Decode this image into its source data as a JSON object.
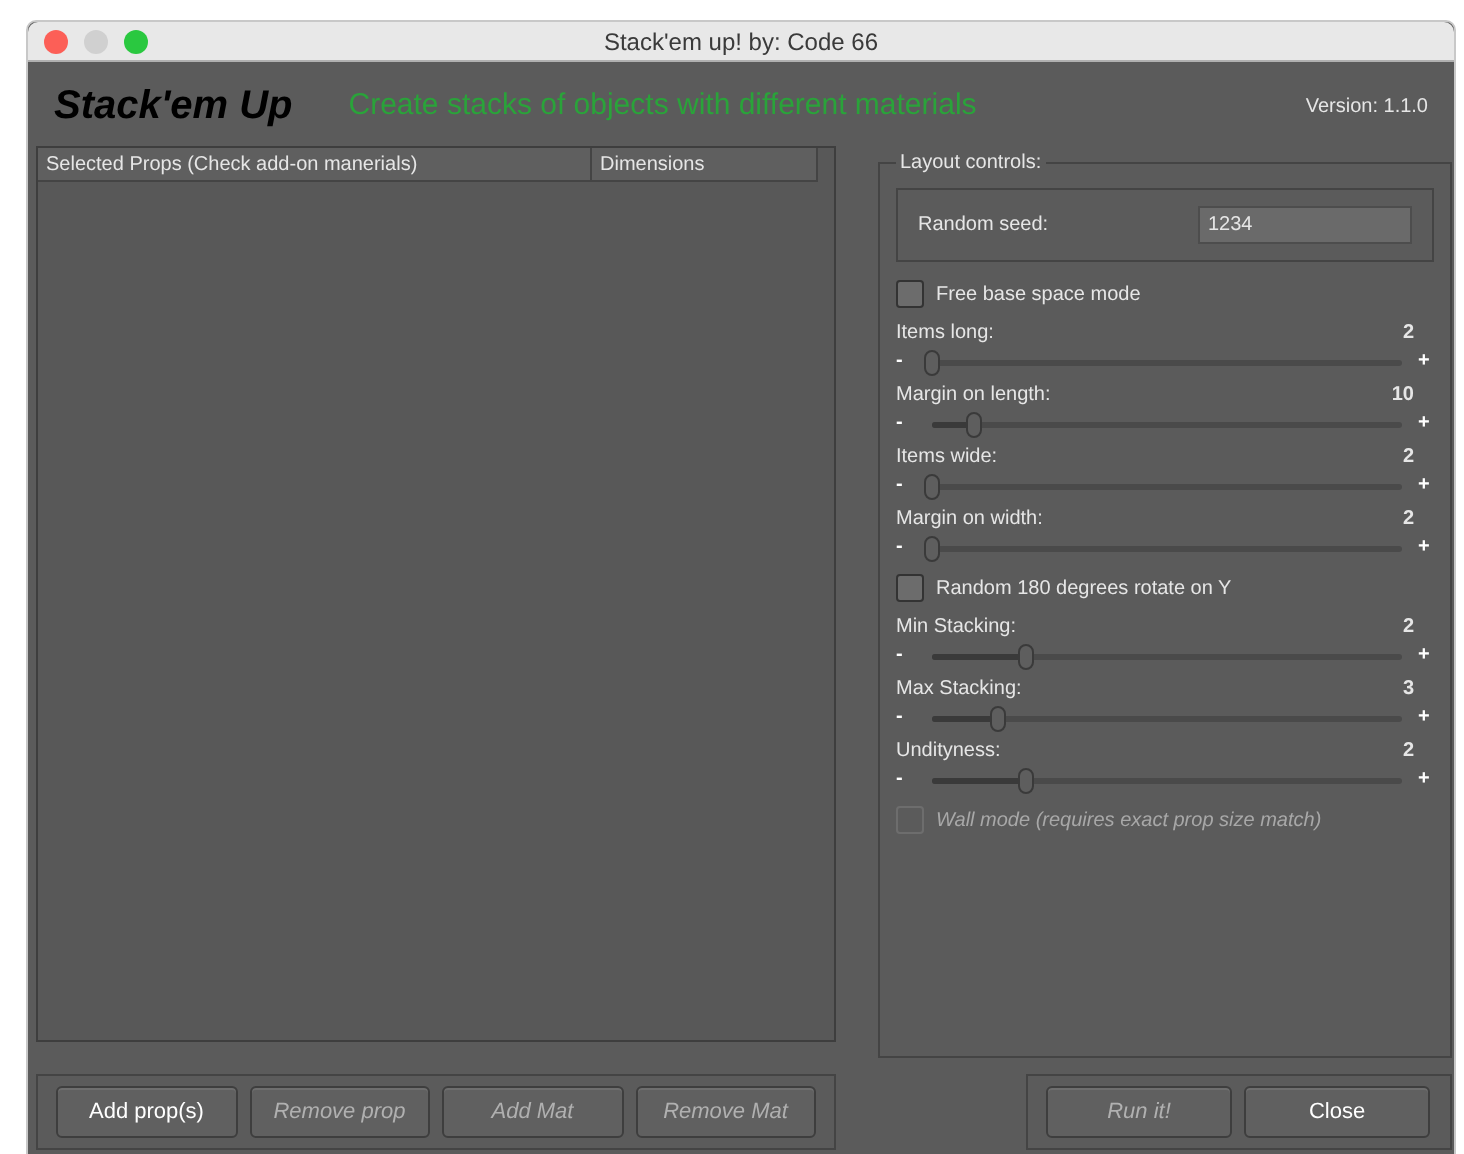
{
  "window": {
    "title": "Stack'em up! by: Code 66"
  },
  "header": {
    "title": "Stack'em Up",
    "subtitle": "Create stacks of objects with different materials",
    "version": "Version: 1.1.0"
  },
  "table": {
    "columns": [
      "Selected Props (Check add-on manerials)",
      "Dimensions"
    ]
  },
  "left_buttons": [
    {
      "label": "Add prop(s)",
      "disabled": false
    },
    {
      "label": "Remove prop",
      "disabled": true
    },
    {
      "label": "Add Mat",
      "disabled": true
    },
    {
      "label": "Remove Mat",
      "disabled": true
    }
  ],
  "layout_controls": {
    "title": "Layout controls:",
    "seed_label": "Random seed:",
    "seed_value": "1234",
    "items": [
      {
        "kind": "checkbox",
        "label": "Free base space mode",
        "checked": false,
        "disabled": false
      },
      {
        "kind": "slider",
        "label": "Items long:",
        "reading": "2",
        "minus": "-",
        "plus": "+",
        "level": 0.0
      },
      {
        "kind": "slider",
        "label": "Margin on length:",
        "reading": "10",
        "minus": "-",
        "plus": "+",
        "level": 0.09
      },
      {
        "kind": "slider",
        "label": "Items wide:",
        "reading": "2",
        "minus": "-",
        "plus": "+",
        "level": 0.0
      },
      {
        "kind": "slider",
        "label": "Margin on width:",
        "reading": "2",
        "minus": "-",
        "plus": "+",
        "level": 0.0
      },
      {
        "kind": "checkbox",
        "label": "Random 180 degrees rotate on Y",
        "checked": false,
        "disabled": false
      },
      {
        "kind": "slider",
        "label": "Min Stacking:",
        "reading": "2",
        "minus": "-",
        "plus": "+",
        "level": 0.2
      },
      {
        "kind": "slider",
        "label": "Max Stacking:",
        "reading": "3",
        "minus": "-",
        "plus": "+",
        "level": 0.14
      },
      {
        "kind": "slider",
        "label": "Undityness:",
        "reading": "2",
        "minus": "-",
        "plus": "+",
        "level": 0.2
      },
      {
        "kind": "checkbox",
        "label": "Wall mode (requires exact prop size match)",
        "checked": false,
        "disabled": true
      }
    ]
  },
  "right_buttons": [
    {
      "label": "Run it!",
      "disabled": true
    },
    {
      "label": "Close",
      "disabled": false
    }
  ]
}
